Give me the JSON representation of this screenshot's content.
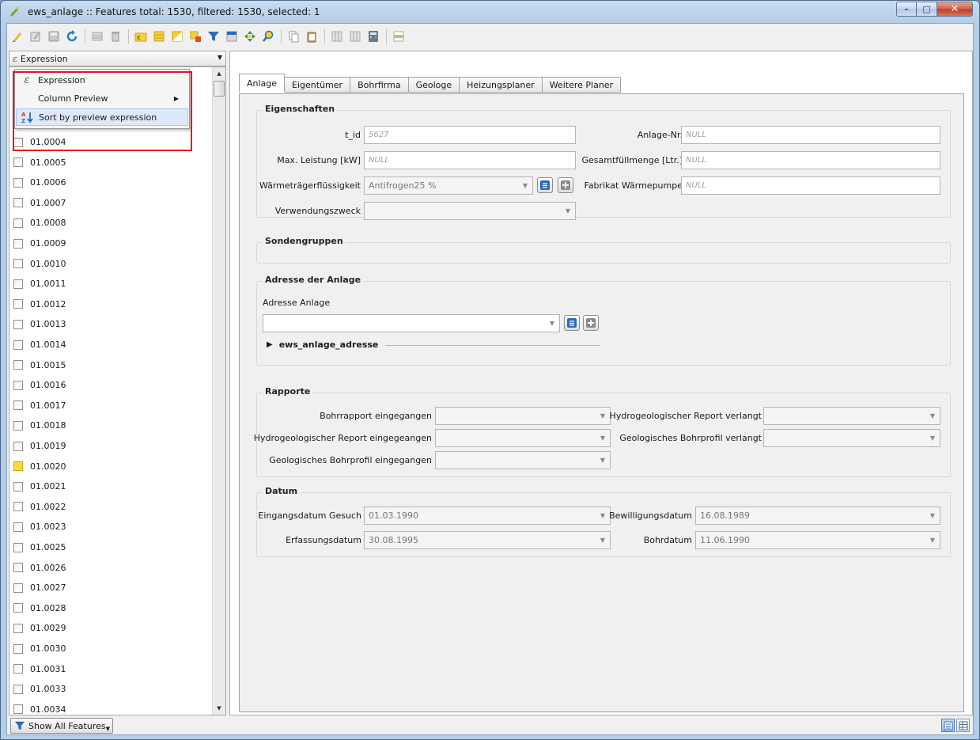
{
  "window": {
    "title": "ews_anlage :: Features total: 1530, filtered: 1530, selected: 1",
    "controls": {
      "minimize": "–",
      "maximize": "□",
      "close": "✕"
    }
  },
  "toolbar": {
    "icons": [
      "pencil-icon",
      "multi-edit-icon",
      "save-edits-icon",
      "reload-icon",
      "add-feature-icon",
      "delete-feature-icon",
      "select-expression-icon",
      "select-all-icon",
      "invert-selection-icon",
      "deselect-icon",
      "filter-icon",
      "move-selection-top-icon",
      "pan-to-selection-icon",
      "zoom-to-selection-icon",
      "copy-icon",
      "paste-icon",
      "new-field-icon",
      "delete-field-icon",
      "field-calculator-icon",
      "conditional-formatting-icon"
    ]
  },
  "left": {
    "expression_combo": "Expression",
    "popup": [
      {
        "label": "Expression",
        "icon": "expression-icon"
      },
      {
        "label": "Column Preview",
        "icon": "",
        "submenu": "▶"
      },
      {
        "label": "Sort by preview expression",
        "icon": "sort-az-icon"
      }
    ],
    "rows": [
      {
        "id": "01.0004",
        "selected": false
      },
      {
        "id": "01.0005",
        "selected": false
      },
      {
        "id": "01.0006",
        "selected": false
      },
      {
        "id": "01.0007",
        "selected": false
      },
      {
        "id": "01.0008",
        "selected": false
      },
      {
        "id": "01.0009",
        "selected": false
      },
      {
        "id": "01.0010",
        "selected": false
      },
      {
        "id": "01.0011",
        "selected": false
      },
      {
        "id": "01.0012",
        "selected": false
      },
      {
        "id": "01.0013",
        "selected": false
      },
      {
        "id": "01.0014",
        "selected": false
      },
      {
        "id": "01.0015",
        "selected": false
      },
      {
        "id": "01.0016",
        "selected": false
      },
      {
        "id": "01.0017",
        "selected": false
      },
      {
        "id": "01.0018",
        "selected": false
      },
      {
        "id": "01.0019",
        "selected": false
      },
      {
        "id": "01.0020",
        "selected": true
      },
      {
        "id": "01.0021",
        "selected": false
      },
      {
        "id": "01.0022",
        "selected": false
      },
      {
        "id": "01.0023",
        "selected": false
      },
      {
        "id": "01.0025",
        "selected": false
      },
      {
        "id": "01.0026",
        "selected": false
      },
      {
        "id": "01.0027",
        "selected": false
      },
      {
        "id": "01.0028",
        "selected": false
      },
      {
        "id": "01.0029",
        "selected": false
      },
      {
        "id": "01.0030",
        "selected": false
      },
      {
        "id": "01.0031",
        "selected": false
      },
      {
        "id": "01.0033",
        "selected": false
      },
      {
        "id": "01.0034",
        "selected": false
      }
    ],
    "show_all": "Show All Features"
  },
  "tabs": [
    "Anlage",
    "Eigentümer",
    "Bohrfirma",
    "Geologe",
    "Heizungsplaner",
    "Weitere Planer"
  ],
  "form": {
    "eigenschaften": {
      "title": "Eigenschaften",
      "t_id_label": "t_id",
      "t_id_value": "5627",
      "anlage_nr_label": "Anlage-Nr.",
      "anlage_nr_value": "NULL",
      "leistung_label": "Max. Leistung [kW]",
      "leistung_value": "NULL",
      "fuellmenge_label": "Gesamtfüllmenge [Ltr.]",
      "fuellmenge_value": "NULL",
      "traeger_label": "Wärmeträgerflüssigkeit",
      "traeger_value": "Antifrogen25 %",
      "fabrikat_label": "Fabrikat Wärmepumpe",
      "fabrikat_value": "NULL",
      "zweck_label": "Verwendungszweck",
      "zweck_value": ""
    },
    "sondengruppen": {
      "title": "Sondengruppen"
    },
    "adresse": {
      "title": "Adresse der Anlage",
      "label": "Adresse Anlage",
      "value": "",
      "relation": "ews_anlage_adresse"
    },
    "rapporte": {
      "title": "Rapporte",
      "bohrrapport_label": "Bohrrapport eingegangen",
      "hydro_verlangt_label": "Hydrogeologischer Report verlangt",
      "hydro_eingegangen_label": "Hydrogeologischer Report eingegeangen",
      "geo_verlangt_label": "Geologisches Bohrprofil verlangt",
      "geo_eingegangen_label": "Geologisches Bohrprofil eingegangen"
    },
    "datum": {
      "title": "Datum",
      "eingang_label": "Eingangsdatum Gesuch",
      "eingang_value": "01.03.1990",
      "bewilligung_label": "Bewilligungsdatum",
      "bewilligung_value": "16.08.1989",
      "erfassung_label": "Erfassungsdatum",
      "erfassung_value": "30.08.1995",
      "bohr_label": "Bohrdatum",
      "bohr_value": "11.06.1990"
    }
  },
  "colors": {
    "highlight_outline": "#e8141c",
    "selected_row": "#ffd83a"
  }
}
